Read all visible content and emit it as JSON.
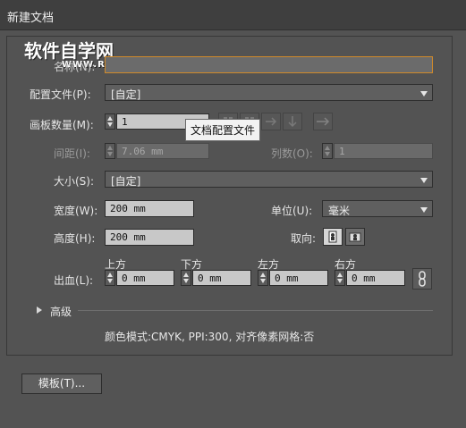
{
  "window": {
    "title": "新建文档"
  },
  "watermark": {
    "line1": "软件自学网",
    "line2": "WWW.RJZXW.COM"
  },
  "name": {
    "label": "名称(N):",
    "value": ""
  },
  "profile": {
    "label": "配置文件(P):",
    "value": "[自定]"
  },
  "artboards": {
    "count_label": "画板数量(M):",
    "count_value": "1",
    "spacing_label": "间距(I):",
    "spacing_value": "7.06 mm",
    "columns_label": "列数(O):",
    "columns_value": "1"
  },
  "tooltip": {
    "text": "文档配置文件"
  },
  "size": {
    "label": "大小(S):",
    "value": "[自定]"
  },
  "width": {
    "label": "宽度(W):",
    "value": "200 mm"
  },
  "height": {
    "label": "高度(H):",
    "value": "200 mm"
  },
  "units": {
    "label": "单位(U):",
    "value": "毫米"
  },
  "orientation": {
    "label": "取向:",
    "selected": "portrait"
  },
  "bleed": {
    "label": "出血(L):",
    "top_label": "上方",
    "top_value": "0 mm",
    "bottom_label": "下方",
    "bottom_value": "0 mm",
    "left_label": "左方",
    "left_value": "0 mm",
    "right_label": "右方",
    "right_value": "0 mm"
  },
  "advanced": {
    "label": "高级",
    "summary": "颜色模式:CMYK, PPI:300, 对齐像素网格:否"
  },
  "buttons": {
    "templates_label": "模板(T)..."
  }
}
